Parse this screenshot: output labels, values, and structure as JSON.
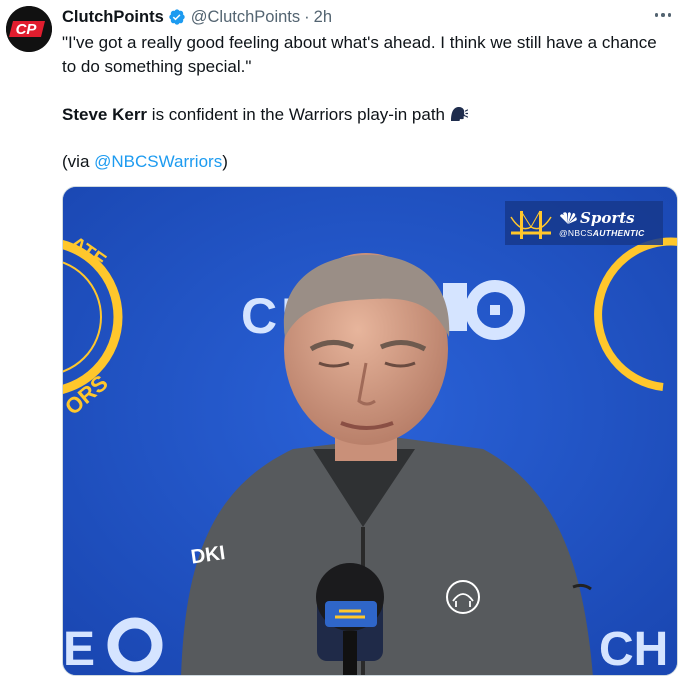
{
  "tweet": {
    "author_name": "ClutchPoints",
    "author_handle": "@ClutchPoints",
    "separator": "·",
    "time": "2h",
    "avatar_text": "CP",
    "text": {
      "quote": "\"I've got a really good feeling about what's ahead. I think we still have a chance to do something special.\"",
      "mention_name": "Steve Kerr",
      "line2_rest": " is confident in the Warriors play-in path",
      "via_prefix": "(via ",
      "via_handle": "@NBCSWarriors",
      "via_suffix": ")"
    },
    "media": {
      "broadcaster_brand": "Sports",
      "broadcaster_sub_prefix": "@NBCS",
      "broadcaster_sub_bold": "AUTHENTIC",
      "backdrop_text_left": "CH",
      "backdrop_text_right": "E",
      "backdrop_text_bottom_left": "E",
      "backdrop_text_bottom_right": "CH",
      "seal_text_top": "ATE",
      "seal_text_bottom": "ORS",
      "jacket_text": "DKI"
    }
  },
  "colors": {
    "accent": "#1d9bf0",
    "verified": "#1d9bf0",
    "backdrop_blue": "#1f55c8",
    "muted": "#536471"
  },
  "icons": {
    "verified": "verified-badge-icon",
    "more": "more-options-icon",
    "emoji": "speaking-head-emoji"
  }
}
